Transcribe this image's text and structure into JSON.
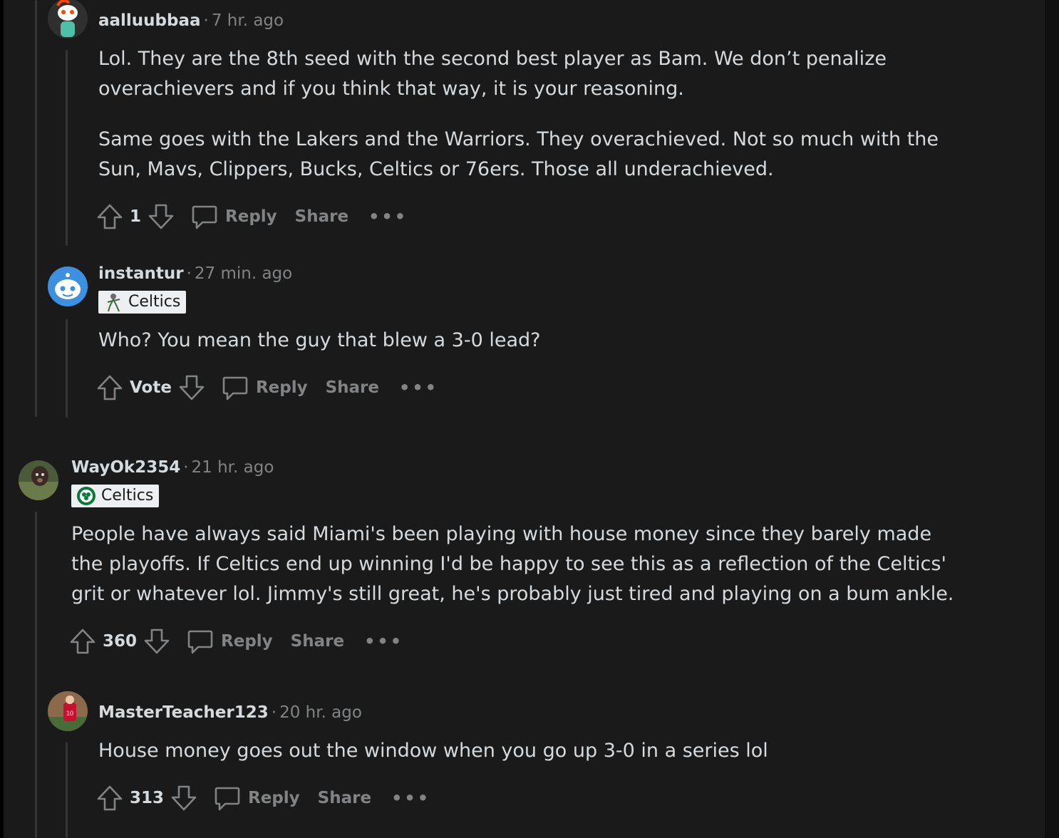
{
  "comments": [
    {
      "username": "aalluubbaa",
      "time": "7 hr. ago",
      "paragraphs": [
        "Lol. They are the 8th seed with the second best player as Bam. We don’t penalize overachievers and if you think that way, it is your reasoning.",
        "Same goes with the Lakers and the Warriors. They overachieved. Not so much with the Sun, Mavs, Clippers, Bucks, Celtics or 76ers. Those all underachieved."
      ],
      "score": "1",
      "reply": "Reply",
      "share": "Share",
      "more": "•••"
    },
    {
      "username": "instantur",
      "time": "27 min. ago",
      "flair": "Celtics",
      "paragraphs": [
        "Who? You mean the guy that blew a 3-0 lead?"
      ],
      "score": "Vote",
      "reply": "Reply",
      "share": "Share",
      "more": "•••"
    },
    {
      "username": "WayOk2354",
      "time": "21 hr. ago",
      "flair": "Celtics",
      "paragraphs": [
        "People have always said Miami's been playing with house money since they barely made the playoffs. If Celtics end up winning I'd be happy to see this as a reflection of the Celtics' grit or whatever lol. Jimmy's still great, he's probably just tired and playing on a bum ankle."
      ],
      "score": "360",
      "reply": "Reply",
      "share": "Share",
      "more": "•••"
    },
    {
      "username": "MasterTeacher123",
      "time": "20 hr. ago",
      "paragraphs": [
        "House money goes out the window when you go up 3-0 in a series lol"
      ],
      "score": "313",
      "reply": "Reply",
      "share": "Share",
      "more": "•••"
    }
  ],
  "separator": "·",
  "colors": {
    "background": "#1a1a1b",
    "text": "#d7dadc",
    "muted": "#818384",
    "thread_line": "#343536",
    "flair_bg": "#edeff1"
  }
}
